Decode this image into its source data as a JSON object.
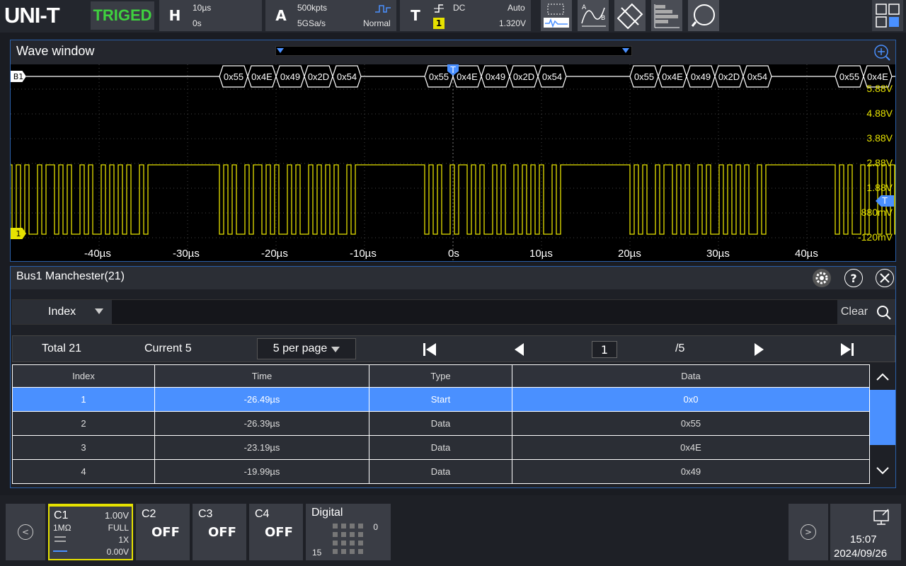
{
  "brand": {
    "logo": "UNI-T",
    "status": "TRIGED"
  },
  "horizontal": {
    "label": "H",
    "timebase": "10µs",
    "offset": "0s"
  },
  "acquire": {
    "label": "A",
    "depth": "500kpts",
    "rate": "5GSa/s",
    "mode": "Normal"
  },
  "trigger": {
    "label": "T",
    "coupling": "DC",
    "mode": "Auto",
    "source": "1",
    "level": "1.320V"
  },
  "wave": {
    "title": "Wave window",
    "bus_label": "B1",
    "ch1_marker": "1",
    "trigger_marker": "T",
    "decode_frames": [
      [
        "0x55",
        "0x4E",
        "0x49",
        "0x2D",
        "0x54"
      ],
      [
        "0x55",
        "0x4E",
        "0x49",
        "0x2D",
        "0x54"
      ],
      [
        "0x55",
        "0x4E",
        "0x49",
        "0x2D",
        "0x54"
      ],
      [
        "0x55",
        "0x4E"
      ]
    ],
    "volt_labels": [
      "5.88V",
      "4.88V",
      "3.88V",
      "2.88V",
      "1.88V",
      "880mV",
      "-120mV"
    ],
    "time_labels": [
      "-40µs",
      "-30µs",
      "-20µs",
      "-10µs",
      "0s",
      "10µs",
      "20µs",
      "30µs",
      "40µs"
    ]
  },
  "bus": {
    "title": "Bus1 Manchester(21)",
    "filter_label": "Index",
    "clear_label": "Clear",
    "total": "Total 21",
    "current": "Current 5",
    "per_page": "5 per page",
    "page": "1",
    "page_total": "/5",
    "columns": [
      "Index",
      "Time",
      "Type",
      "Data"
    ],
    "rows": [
      {
        "index": "1",
        "time": "-26.49µs",
        "type": "Start",
        "data": "0x0"
      },
      {
        "index": "2",
        "time": "-26.39µs",
        "type": "Data",
        "data": "0x55"
      },
      {
        "index": "3",
        "time": "-23.19µs",
        "type": "Data",
        "data": "0x4E"
      },
      {
        "index": "4",
        "time": "-19.99µs",
        "type": "Data",
        "data": "0x49"
      }
    ]
  },
  "channels": {
    "c1": {
      "name": "C1",
      "scale": "1.00V",
      "impedance": "1MΩ",
      "bw": "FULL",
      "probe": "1X",
      "offset": "0.00V"
    },
    "c2": {
      "name": "C2",
      "state": "OFF"
    },
    "c3": {
      "name": "C3",
      "state": "OFF"
    },
    "c4": {
      "name": "C4",
      "state": "OFF"
    },
    "digital": {
      "name": "Digital",
      "low": "15",
      "high": "0"
    }
  },
  "clock": {
    "time": "15:07",
    "date": "2024/09/26"
  },
  "colors": {
    "ch1": "#e6e200",
    "accent": "#4a90ff",
    "triged": "#3fd13f"
  }
}
